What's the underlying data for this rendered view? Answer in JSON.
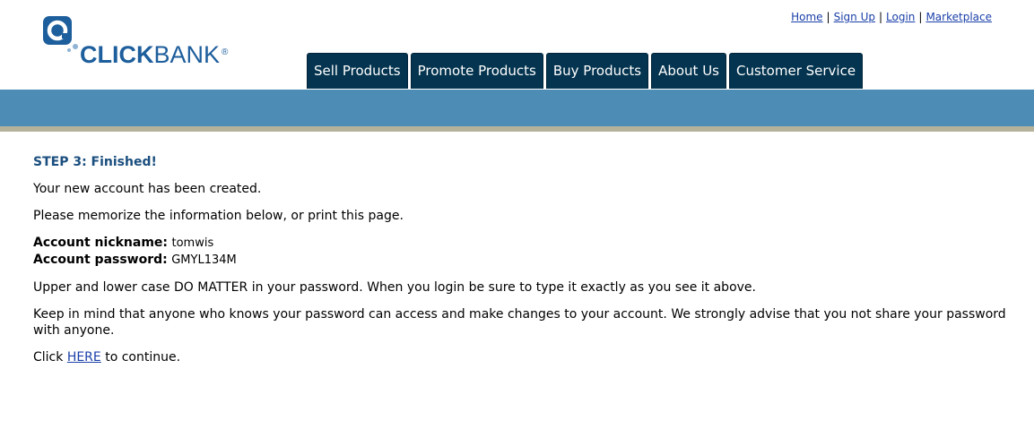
{
  "logo": {
    "text_strong": "CLICK",
    "text_light": "BANK",
    "registered_mark": "®"
  },
  "top_links": {
    "home": "Home",
    "signup": "Sign Up",
    "login": "Login",
    "marketplace": "Marketplace",
    "separator": "|"
  },
  "tabs": [
    {
      "label": "Sell Products"
    },
    {
      "label": "Promote Products"
    },
    {
      "label": "Buy Products"
    },
    {
      "label": "About Us"
    },
    {
      "label": "Customer Service"
    }
  ],
  "content": {
    "step_title": "STEP 3: Finished!",
    "created_msg": "Your new account has been created.",
    "memorize_msg": "Please memorize the information below, or print this page.",
    "nickname_label": "Account nickname:",
    "nickname_value": "tomwis",
    "password_label": "Account password:",
    "password_value": "GMYL134M",
    "case_msg": "Upper and lower case DO MATTER in your password. When you login be sure to type it exactly as you see it above.",
    "keep_msg": "Keep in mind that anyone who knows your password can access and make changes to your account. We strongly advise that you not share your password with anyone.",
    "click_prefix": "Click",
    "here_link": "HERE",
    "click_suffix": "to continue."
  },
  "colors": {
    "tab_bg": "#04344f",
    "band": "#4d8db5",
    "band_line": "#b5b29b",
    "brand_blue": "#1d5e9c",
    "link": "#1a3fa8",
    "step_title": "#1a4e7e"
  }
}
